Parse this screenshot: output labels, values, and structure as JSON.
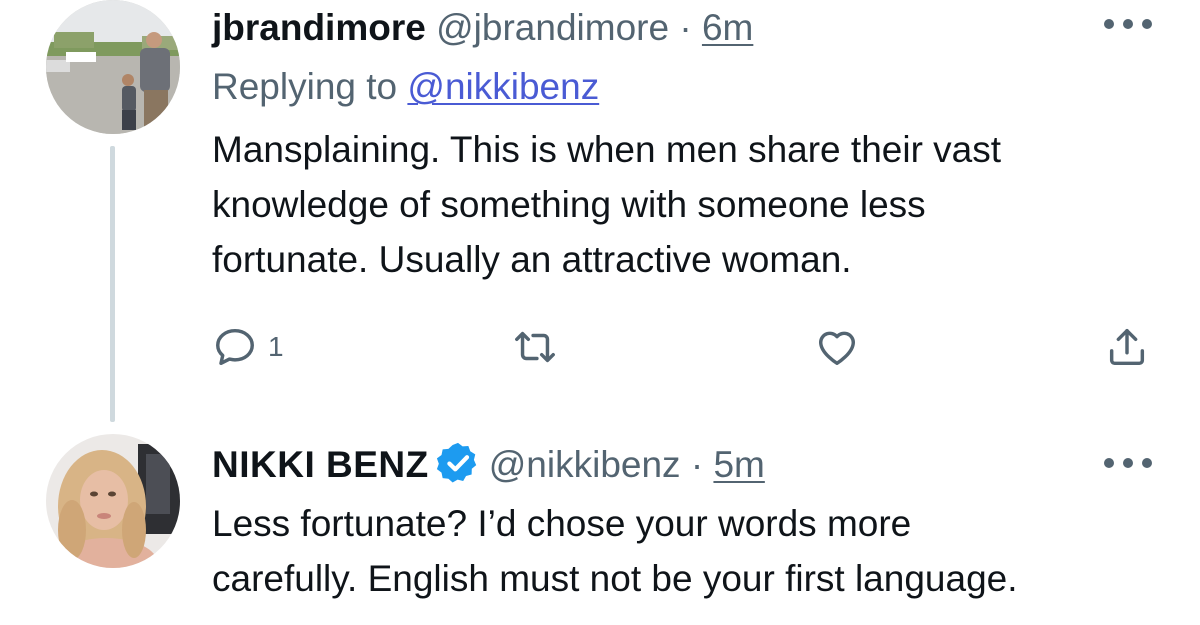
{
  "tweet_1": {
    "display_name": "jbrandimore",
    "handle": "@jbrandimore",
    "separator": "·",
    "time": "6m",
    "replying_prefix": "Replying to",
    "replying_to": "@nikkibenz",
    "text_lines": [
      "Mansplaining. This is when men share their vast",
      "knowledge of something with someone less",
      "fortunate. Usually an attractive woman."
    ],
    "reply_count": "1",
    "icons": {
      "avatar": "avatar-photo",
      "more": "more-icon",
      "reply": "reply-icon",
      "retweet": "retweet-icon",
      "like": "heart-icon",
      "share": "share-icon"
    }
  },
  "tweet_2": {
    "display_name": "NIKKI BENZ",
    "verified": true,
    "handle": "@nikkibenz",
    "separator": "·",
    "time": "5m",
    "text_lines": [
      "Less fortunate? I’d chose your words more",
      "carefully. English must not be your first language."
    ],
    "icons": {
      "avatar": "avatar-photo",
      "verified": "verified-badge-icon",
      "more": "more-icon"
    }
  },
  "colors": {
    "text": "#0f1419",
    "secondary": "#536471",
    "mention": "#4a5bd4",
    "verified": "#1d9bf0",
    "thread_line": "#cfd9de"
  }
}
